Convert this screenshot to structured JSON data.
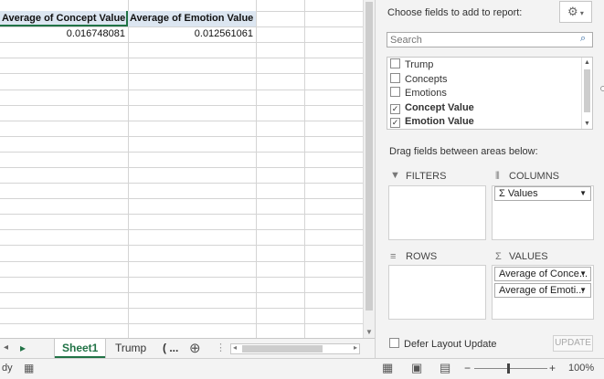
{
  "grid": {
    "headers": [
      "Average of Concept Value",
      "Average of Emotion Value"
    ],
    "values": [
      "0.016748081",
      "0.012561061"
    ]
  },
  "sheet_tabs": {
    "nav_next": "▸",
    "tabs": [
      "Sheet1",
      "Trump",
      "( ..."
    ],
    "active": "Sheet1",
    "add_icon": "⊕"
  },
  "status": {
    "ready_text": "dy",
    "zoom": "100%",
    "zoom_minus": "−",
    "zoom_plus": "+"
  },
  "pivot_panel": {
    "choose_label": "Choose fields to add to report:",
    "search_placeholder": "Search",
    "fields": [
      {
        "label": "Trump",
        "checked": false
      },
      {
        "label": "Concepts",
        "checked": false
      },
      {
        "label": "Emotions",
        "checked": false
      },
      {
        "label": "Concept Value",
        "checked": true
      },
      {
        "label": "Emotion Value",
        "checked": true
      }
    ],
    "drag_label": "Drag fields between areas below:",
    "areas": {
      "filters": {
        "title": "FILTERS",
        "items": []
      },
      "columns": {
        "title": "COLUMNS",
        "items": [
          "Σ  Values"
        ]
      },
      "rows": {
        "title": "ROWS",
        "items": []
      },
      "values": {
        "title": "VALUES",
        "items": [
          "Average of Conce...",
          "Average of Emoti..."
        ]
      }
    },
    "defer_label": "Defer Layout Update",
    "update_label": "UPDATE"
  },
  "colors": {
    "accent": "#217346",
    "header_fill": "#dce6f1"
  }
}
